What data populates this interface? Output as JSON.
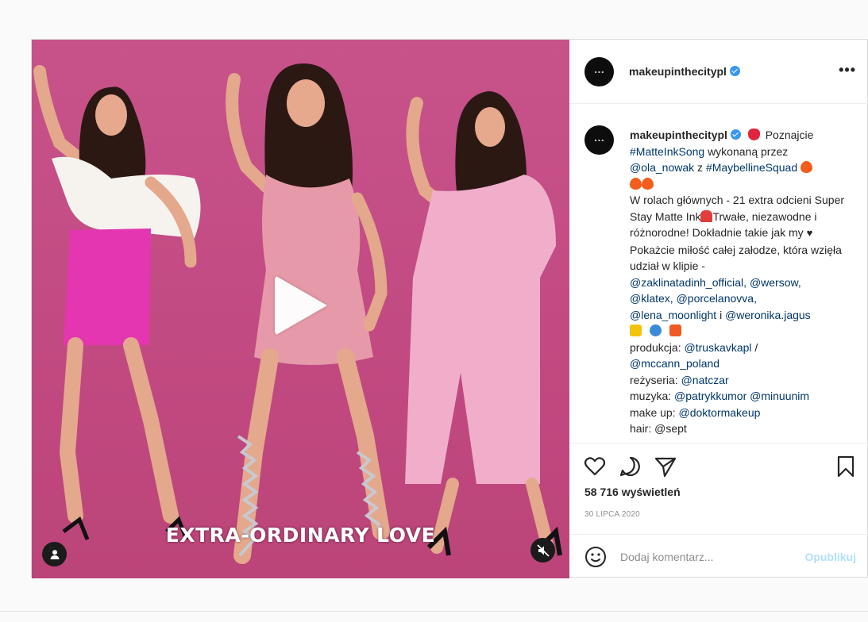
{
  "post": {
    "video": {
      "overlay_text": "EXTRA-ORDINARY LOVE",
      "play_icon": "play-icon",
      "user_tag_icon": "user-icon",
      "mute_icon": "muted-speaker-icon"
    },
    "header": {
      "username": "makeupinthecitypl",
      "more_label": "•••"
    },
    "caption": {
      "username": "makeupinthecitypl",
      "p1": "Poznajcie",
      "tag_song": "#MatteInkSong",
      "p2": "wykonaną przez",
      "tag_ola": "@ola_nowak",
      "p3": "z",
      "tag_squad": "#MaybellineSquad",
      "p4": "W rolach głównych - 21 extra odcieni Super Stay Matte Ink",
      "p5": "Trwałe, niezawodne i różnorodne! Dokładnie takie jak my",
      "p6": "Pokażcie miłość całej załodze, która wzięła udział w klipie -",
      "tag_zak": "@zaklinatadinh_official,",
      "tag_wersow": "@wersow,",
      "tag_klatex": "@klatex,",
      "tag_porcel": "@porcelanovva,",
      "tag_lena": "@lena_moonlight",
      "p7": "i",
      "tag_weronika": "@weronika.jagus",
      "prod_label": "produkcja:",
      "tag_truskav": "@truskavkapl",
      "slash": "/",
      "tag_mccann": "@mccann_poland",
      "dir_label": "reżyseria:",
      "tag_natczar": "@natczar",
      "music_label": "muzyka:",
      "tag_patryk": "@patrykkumor",
      "tag_minu": "@minuunim",
      "makeup_label": "make up:",
      "tag_doktor": "@doktormakeup",
      "cut_line": "hair: @sept"
    },
    "actions": {
      "views": "58 716 wyświetleń",
      "date": "30 LIPCA 2020"
    },
    "comment_box": {
      "placeholder": "Dodaj komentarz...",
      "publish": "Opublikuj"
    },
    "colors": {
      "link": "#00376b",
      "verified": "#3897f0",
      "publish_disabled": "#b2dffc",
      "video_bg": "#c24a82"
    }
  }
}
